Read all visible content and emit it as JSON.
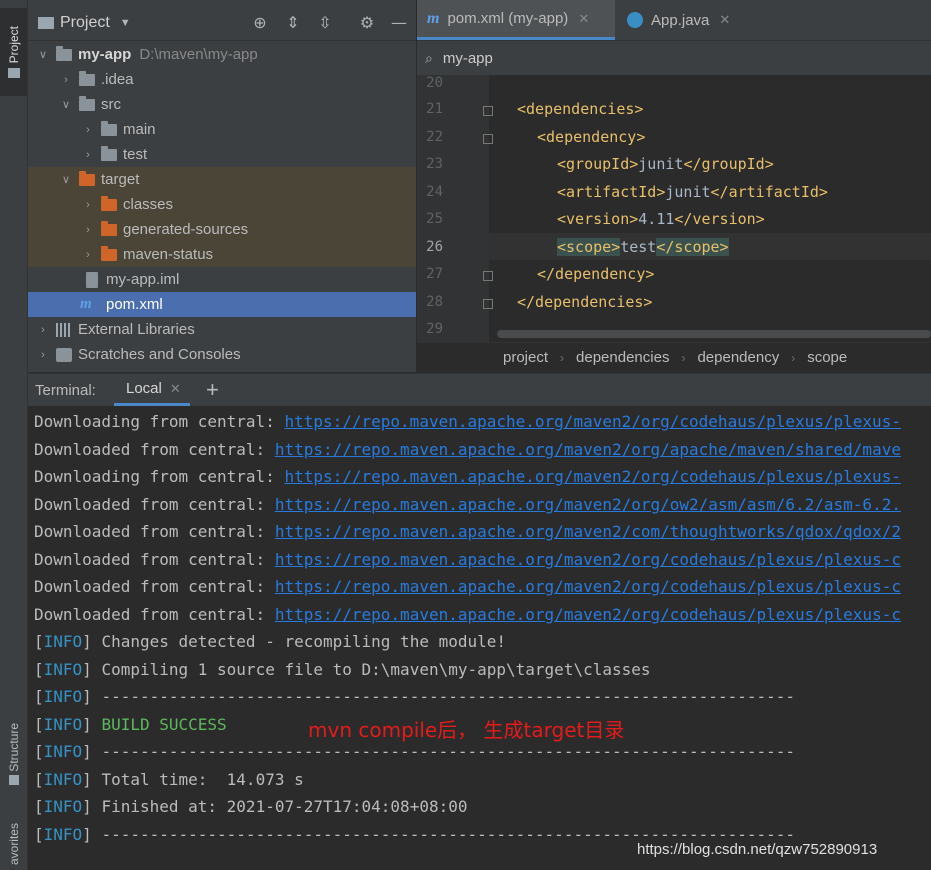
{
  "left_strip": {
    "project_label": "Project",
    "structure_label": "Structure",
    "favorites_label": "avorites"
  },
  "project_panel": {
    "title": "Project",
    "tree": [
      {
        "label": "my-app",
        "path": "D:\\maven\\my-app",
        "icon": "module-folder-icon",
        "expanded": true
      },
      {
        "label": ".idea",
        "icon": "folder-icon"
      },
      {
        "label": "src",
        "icon": "folder-icon"
      },
      {
        "label": "main",
        "icon": "folder-icon"
      },
      {
        "label": "test",
        "icon": "folder-icon"
      },
      {
        "label": "target",
        "icon": "excluded-folder-icon"
      },
      {
        "label": "classes",
        "icon": "excluded-folder-icon"
      },
      {
        "label": "generated-sources",
        "icon": "excluded-folder-icon"
      },
      {
        "label": "maven-status",
        "icon": "excluded-folder-icon"
      },
      {
        "label": "my-app.iml",
        "icon": "iml-file-icon"
      },
      {
        "label": "pom.xml",
        "icon": "maven-file-icon",
        "selected": true
      },
      {
        "label": "External Libraries",
        "icon": "libraries-icon"
      },
      {
        "label": "Scratches and Consoles",
        "icon": "scratches-icon"
      }
    ]
  },
  "editor": {
    "tabs": [
      {
        "label": "pom.xml (my-app)",
        "active": true
      },
      {
        "label": "App.java",
        "active": false
      }
    ],
    "search_value": "my-app",
    "line_numbers": [
      "20",
      "21",
      "22",
      "23",
      "24",
      "25",
      "26",
      "27",
      "28",
      "29"
    ],
    "current_line": "26",
    "code": {
      "l21_open": "<dependencies>",
      "l22_open": "<dependency>",
      "l23_open": "<groupId>",
      "l23_val": "junit",
      "l23_close": "</groupId>",
      "l24_open": "<artifactId>",
      "l24_val": "junit",
      "l24_close": "</artifactId>",
      "l25_open": "<version>",
      "l25_val": "4.11",
      "l25_close": "</version>",
      "l26_open": "<scope>",
      "l26_val": "test",
      "l26_close": "</scope>",
      "l27_close": "</dependency>",
      "l28_close": "</dependencies>"
    },
    "breadcrumb": [
      "project",
      "dependencies",
      "dependency",
      "scope"
    ]
  },
  "terminal": {
    "title": "Terminal:",
    "tab_label": "Local",
    "add_label": "+",
    "lines": [
      {
        "prefix": "Downloading from central: ",
        "link": "https://repo.maven.apache.org/maven2/org/codehaus/plexus/plexus-"
      },
      {
        "prefix": "Downloaded from central: ",
        "link": "https://repo.maven.apache.org/maven2/org/apache/maven/shared/mave"
      },
      {
        "prefix": "Downloading from central: ",
        "link": "https://repo.maven.apache.org/maven2/org/codehaus/plexus/plexus-"
      },
      {
        "prefix": "Downloaded from central: ",
        "link": "https://repo.maven.apache.org/maven2/org/ow2/asm/asm/6.2/asm-6.2."
      },
      {
        "prefix": "Downloaded from central: ",
        "link": "https://repo.maven.apache.org/maven2/com/thoughtworks/qdox/qdox/2"
      },
      {
        "prefix": "Downloaded from central: ",
        "link": "https://repo.maven.apache.org/maven2/org/codehaus/plexus/plexus-c"
      },
      {
        "prefix": "Downloaded from central: ",
        "link": "https://repo.maven.apache.org/maven2/org/codehaus/plexus/plexus-c"
      },
      {
        "prefix": "Downloaded from central: ",
        "link": "https://repo.maven.apache.org/maven2/org/codehaus/plexus/plexus-c"
      }
    ],
    "info_tag": "INFO",
    "info_lines": [
      "Changes detected - recompiling the module!",
      "Compiling 1 source file to D:\\maven\\my-app\\target\\classes",
      "------------------------------------------------------------------------",
      "BUILD SUCCESS",
      "------------------------------------------------------------------------",
      "Total time:  14.073 s",
      "Finished at: 2021-07-27T17:04:08+08:00",
      "------------------------------------------------------------------------"
    ],
    "annotation": "mvn compile后， 生成target目录"
  },
  "watermark": "https://blog.csdn.net/qzw752890913",
  "colors": {
    "selection": "#4b6eaf",
    "excluded_bg": "#4b4538",
    "xml_tag": "#e8bf6a",
    "link": "#287bde",
    "info": "#3592c4",
    "success": "#5cb85c",
    "annotation": "#e31b1b"
  }
}
